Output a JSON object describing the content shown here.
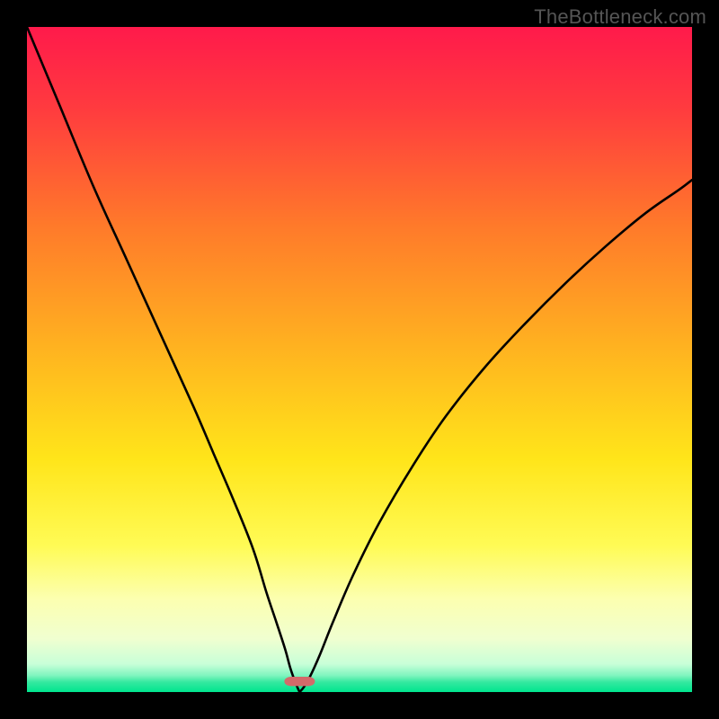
{
  "watermark": "TheBottleneck.com",
  "chart_data": {
    "type": "line",
    "title": "",
    "xlabel": "",
    "ylabel": "",
    "xlim": [
      0,
      100
    ],
    "ylim": [
      0,
      100
    ],
    "gradient_bands": [
      {
        "stop": 0.0,
        "color": "#ff1a4b"
      },
      {
        "stop": 0.12,
        "color": "#ff3a3f"
      },
      {
        "stop": 0.3,
        "color": "#ff7a2a"
      },
      {
        "stop": 0.5,
        "color": "#ffb81f"
      },
      {
        "stop": 0.65,
        "color": "#ffe51a"
      },
      {
        "stop": 0.78,
        "color": "#fffb55"
      },
      {
        "stop": 0.86,
        "color": "#fcffb0"
      },
      {
        "stop": 0.92,
        "color": "#f0ffd0"
      },
      {
        "stop": 0.958,
        "color": "#c8ffd8"
      },
      {
        "stop": 0.975,
        "color": "#80f5bf"
      },
      {
        "stop": 0.985,
        "color": "#35e9a0"
      },
      {
        "stop": 1.0,
        "color": "#00e58e"
      }
    ],
    "optimum_x": 41,
    "marker": {
      "x": 41,
      "y": 98.4,
      "w": 4.6,
      "h": 1.4,
      "rx": 1.0,
      "color": "#d46a6a"
    },
    "series": [
      {
        "name": "left-curve",
        "x": [
          0,
          5,
          10,
          15,
          20,
          25,
          28,
          31,
          34,
          36,
          37.5,
          38.8,
          39.6,
          40.3,
          40.8,
          41.0
        ],
        "y": [
          100,
          88,
          76,
          65,
          54,
          43,
          36,
          29,
          21.5,
          15,
          10.5,
          6.5,
          3.6,
          1.6,
          0.4,
          0.0
        ]
      },
      {
        "name": "right-curve",
        "x": [
          41.0,
          41.6,
          42.5,
          44,
          46,
          49,
          53,
          58,
          63,
          69,
          75,
          81,
          87,
          93,
          98,
          100
        ],
        "y": [
          0.0,
          0.7,
          2.2,
          5.5,
          10.5,
          17.5,
          25.5,
          34.0,
          41.5,
          49.0,
          55.5,
          61.5,
          67.0,
          72.0,
          75.5,
          77.0
        ]
      }
    ]
  }
}
